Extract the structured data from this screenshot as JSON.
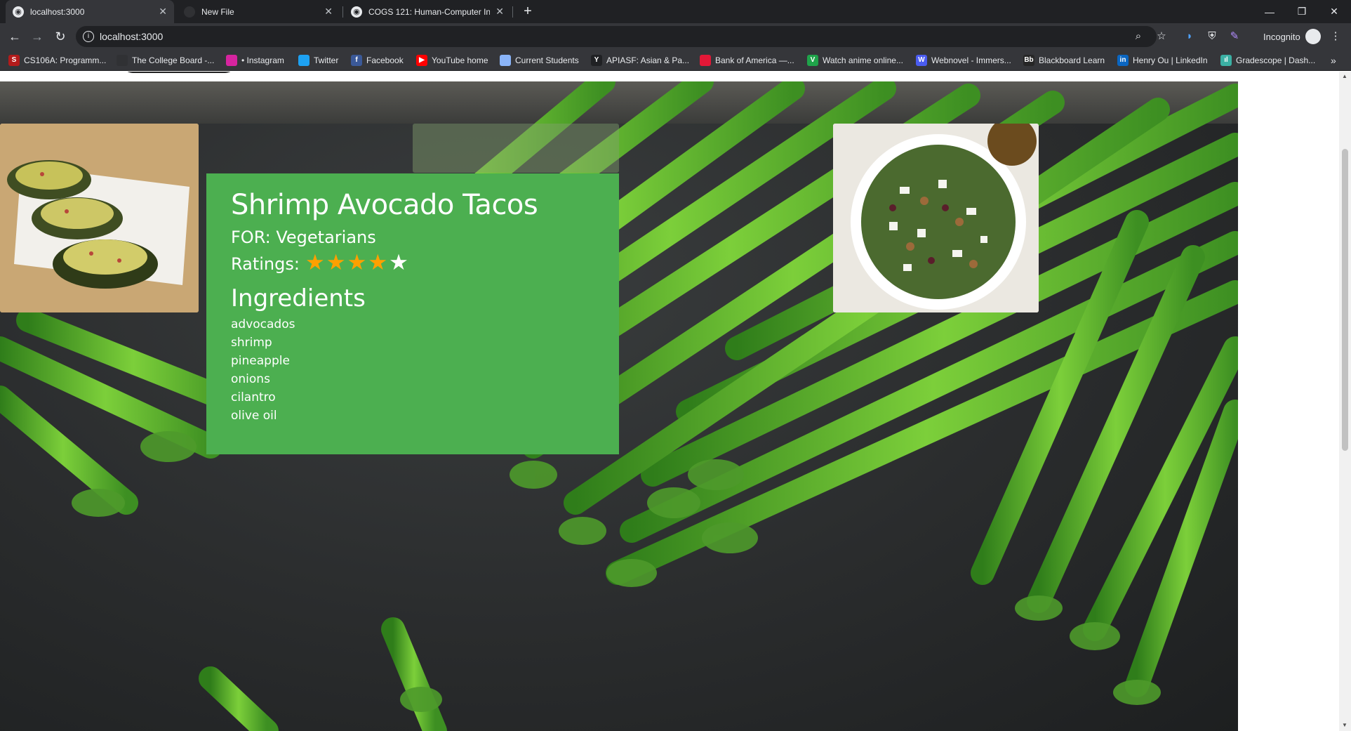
{
  "browser": {
    "tabs": [
      {
        "label": "localhost:3000",
        "active": true
      },
      {
        "label": "New File",
        "active": false
      },
      {
        "label": "COGS 121: Human-Computer Int",
        "active": false
      }
    ],
    "url": "localhost:3000",
    "incognito_label": "Incognito",
    "bookmarks": [
      {
        "label": "CS106A: Programm...",
        "icon": "s-icon",
        "color": "#b31b1b",
        "glyph": "S"
      },
      {
        "label": "The College Board -...",
        "icon": "acorn-icon",
        "color": "#303134",
        "glyph": ""
      },
      {
        "label": "• Instagram",
        "icon": "instagram-icon",
        "color": "#d6249f",
        "glyph": ""
      },
      {
        "label": "Twitter",
        "icon": "twitter-icon",
        "color": "#1da1f2",
        "glyph": ""
      },
      {
        "label": "Facebook",
        "icon": "facebook-icon",
        "color": "#3b5998",
        "glyph": "f"
      },
      {
        "label": "YouTube home",
        "icon": "youtube-icon",
        "color": "#ff0000",
        "glyph": "▶"
      },
      {
        "label": "Current Students",
        "icon": "page-icon",
        "color": "#8ab4f8",
        "glyph": ""
      },
      {
        "label": "APIASF: Asian & Pa...",
        "icon": "y-icon",
        "color": "#202124",
        "glyph": "Y"
      },
      {
        "label": "Bank of America —...",
        "icon": "bofa-icon",
        "color": "#e31837",
        "glyph": ""
      },
      {
        "label": "Watch anime online...",
        "icon": "anime-icon",
        "color": "#1fa34a",
        "glyph": "V"
      },
      {
        "label": "Webnovel - Immers...",
        "icon": "webnovel-icon",
        "color": "#4a5cf0",
        "glyph": "W"
      },
      {
        "label": "Blackboard Learn",
        "icon": "blackboard-icon",
        "color": "#262626",
        "glyph": "Bb"
      },
      {
        "label": "Henry Ou | LinkedIn",
        "icon": "linkedin-icon",
        "color": "#0a66c2",
        "glyph": "in"
      },
      {
        "label": "Gradescope | Dash...",
        "icon": "gradescope-icon",
        "color": "#3bb0a4",
        "glyph": "ıl"
      }
    ]
  },
  "recipe": {
    "title": "Shrimp Avocado Tacos",
    "for_text": "FOR: Vegetarians",
    "ratings_label": "Ratings:",
    "rating": 4,
    "rating_max": 5,
    "ingredients_title": "Ingredients",
    "ingredients": [
      "advocados",
      "shrimp",
      "pineapple",
      "onions",
      "cilantro",
      "olive oil"
    ]
  },
  "colors": {
    "card_green": "#4caf50",
    "star_filled": "#ffa000",
    "star_empty": "#ffffff"
  }
}
